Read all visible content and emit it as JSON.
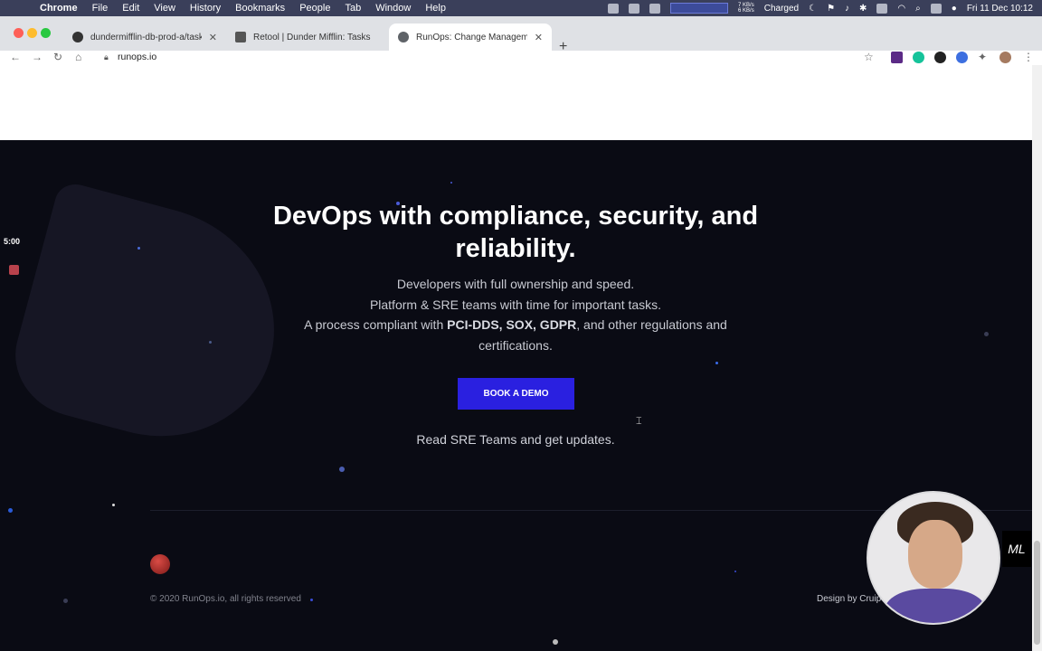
{
  "menubar": {
    "app": "Chrome",
    "items": [
      "File",
      "Edit",
      "View",
      "History",
      "Bookmarks",
      "People",
      "Tab",
      "Window",
      "Help"
    ],
    "net_up": "7 KB/s",
    "net_down": "6 KB/s",
    "battery": "Charged",
    "clock": "Fri 11 Dec  10:12"
  },
  "tabs": [
    {
      "label": "dundermifflin-db-prod-a/task_",
      "favicon": "github-icon"
    },
    {
      "label": "Retool | Dunder Mifflin: Tasks",
      "favicon": "retool-icon"
    },
    {
      "label": "RunOps: Change Management",
      "favicon": "globe-icon"
    }
  ],
  "toolbar": {
    "url": "runops.io"
  },
  "hero": {
    "title": "DevOps with compliance, security, and reliability.",
    "line1": "Developers with full ownership and speed.",
    "line2": "Platform & SRE teams with time for important tasks.",
    "line3_prefix": "A process compliant with ",
    "line3_bold": "PCI-DDS, SOX, GDPR",
    "line3_suffix": ", and other regulations and",
    "line4": "certifications.",
    "cta": "BOOK A DEMO",
    "tagline": "Read SRE Teams and get updates."
  },
  "footer": {
    "copyright": "© 2020 RunOps.io, all rights reserved",
    "design": "Design by Cruip"
  },
  "overlay": {
    "timer": "5:00",
    "badge": "ML"
  },
  "colors": {
    "accent": "#2a20e0",
    "background": "#0a0b14"
  }
}
